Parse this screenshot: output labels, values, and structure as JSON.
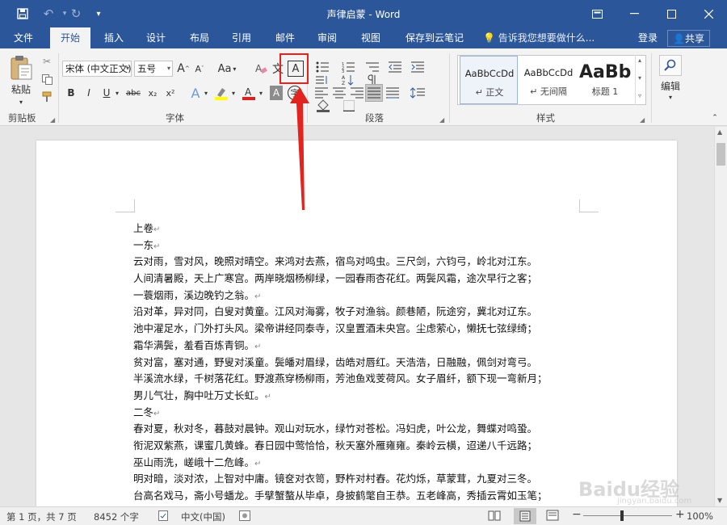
{
  "titlebar": {
    "title": "声律启蒙 - Word",
    "colors": {
      "brand": "#2b579a"
    }
  },
  "menu": {
    "tabs": [
      "文件",
      "开始",
      "插入",
      "设计",
      "布局",
      "引用",
      "邮件",
      "审阅",
      "视图",
      "保存到云笔记"
    ],
    "active_index": 1,
    "tell_me": "告诉我您想要做什么...",
    "login": "登录",
    "share": "共享"
  },
  "ribbon": {
    "clipboard": {
      "paste": "粘贴",
      "label": "剪贴板"
    },
    "font": {
      "name": "宋体 (中文正文)",
      "size": "五号",
      "label": "字体",
      "bold": "B",
      "italic": "I",
      "underline": "U",
      "strike": "abc",
      "sub": "x₂",
      "sup": "x²",
      "char_border": "A",
      "case": "Aa",
      "grow": "A",
      "shrink": "A"
    },
    "paragraph": {
      "label": "段落"
    },
    "styles": {
      "label": "样式",
      "items": [
        {
          "sample": "AaBbCcDd",
          "name": "↵ 正文"
        },
        {
          "sample": "AaBbCcDd",
          "name": "↵ 无间隔"
        },
        {
          "sample": "AaBb",
          "name": "标题 1"
        }
      ]
    },
    "editing": {
      "label": "编辑"
    }
  },
  "document": {
    "lines": [
      "上卷",
      "一东",
      "云对雨，雪对风，晚照对晴空。来鸿对去燕，宿鸟对鸣虫。三尺剑，六钧弓，岭北对江东。",
      "人间清暑殿，天上广寒宫。两岸晓烟杨柳绿，一园春雨杏花红。两鬓风霜，途次早行之客；",
      "一蓑烟雨，溪边晚钓之翁。",
      "沿对革，异对同，白叟对黄童。江风对海雾，牧子对渔翁。颜巷陋，阮途穷，冀北对辽东。",
      "池中濯足水，门外打头风。梁帝讲经同泰寺，汉皇置酒未央宫。尘虑萦心，懒抚七弦绿绮；",
      "霜华满鬓，羞看百炼青铜。",
      "贫对富，塞对通，野叟对溪童。鬓皤对眉绿，齿皓对唇红。天浩浩，日融融，佩剑对弯弓。",
      "半溪流水绿，千树落花红。野渡燕穿杨柳雨，芳池鱼戏芰荷风。女子眉纤，额下现一弯新月；",
      "男儿气壮，胸中吐万丈长虹。",
      "二冬",
      "春对夏，秋对冬，暮鼓对晨钟。观山对玩水，绿竹对苍松。冯妇虎，叶公龙，舞蝶对鸣蛩。",
      "衔泥双紫燕，课蜜几黄蜂。春日园中莺恰恰，秋天塞外雁雍雍。秦岭云横，迢递八千远路；",
      "巫山雨洗，嵯峨十二危峰。",
      "明对暗，淡对浓，上智对中庸。镜奁对衣笥，野杵对村舂。花灼烁，草蒙茸，九夏对三冬。",
      "台高名戏马，斋小号蟠龙。手擘蟹螯从毕卓，身披鹤氅自王恭。五老峰高，秀插云霄如玉笔；"
    ]
  },
  "status": {
    "page": "第 1 页，共 7 页",
    "words": "8452 个字",
    "lang": "中文(中国)",
    "zoom": "100%"
  },
  "watermark": {
    "text": "Baidu经验",
    "sub": "jingyan.baidu.com"
  }
}
